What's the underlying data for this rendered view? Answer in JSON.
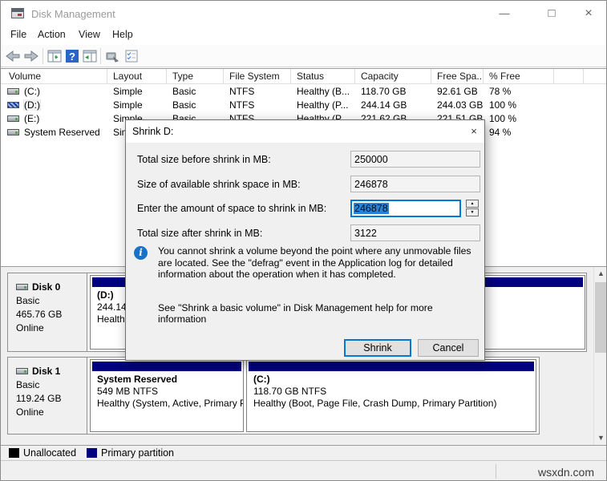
{
  "window": {
    "title": "Disk Management",
    "controls": {
      "minimize": "—",
      "maximize": "□",
      "close": "×"
    }
  },
  "menu": {
    "items": [
      "File",
      "Action",
      "View",
      "Help"
    ]
  },
  "icons": {
    "dialog_close": "×",
    "scroll_up": "▲",
    "scroll_down": "▼",
    "spin_up": "▲",
    "spin_down": "▼",
    "info": "i"
  },
  "volume_table": {
    "columns": [
      "Volume",
      "Layout",
      "Type",
      "File System",
      "Status",
      "Capacity",
      "Free Spa...",
      "% Free"
    ],
    "rows": [
      {
        "volume": "(C:)",
        "layout": "Simple",
        "type": "Basic",
        "fs": "NTFS",
        "status": "Healthy (B...",
        "capacity": "118.70 GB",
        "free": "92.61 GB",
        "pct": "78 %"
      },
      {
        "volume": "(D:)",
        "layout": "Simple",
        "type": "Basic",
        "fs": "NTFS",
        "status": "Healthy (P...",
        "capacity": "244.14 GB",
        "free": "244.03 GB",
        "pct": "100 %"
      },
      {
        "volume": "(E:)",
        "layout": "Simple",
        "type": "Basic",
        "fs": "NTFS",
        "status": "Healthy (P...",
        "capacity": "221.62 GB",
        "free": "221.51 GB",
        "pct": "100 %"
      },
      {
        "volume": "System Reserved",
        "layout": "Simple",
        "type": "",
        "fs": "",
        "status": "",
        "capacity": "",
        "free": "",
        "pct": "94 %"
      }
    ]
  },
  "dialog": {
    "title": "Shrink D:",
    "fields": [
      {
        "label": "Total size before shrink in MB:",
        "value": "250000"
      },
      {
        "label": "Size of available shrink space in MB:",
        "value": "246878"
      },
      {
        "label": "Enter the amount of space to shrink in MB:",
        "value": "246878"
      },
      {
        "label": "Total size after shrink in MB:",
        "value": "3122"
      }
    ],
    "info_text": "You cannot shrink a volume beyond the point where any unmovable files are located. See the \"defrag\" event in the Application log for detailed information about the operation when it has completed.",
    "help_text": "See \"Shrink a basic volume\" in Disk Management help for more information",
    "shrink_label": "Shrink",
    "cancel_label": "Cancel"
  },
  "disks": [
    {
      "name": "Disk 0",
      "type": "Basic",
      "size": "465.76 GB",
      "status": "Online",
      "partitions": [
        {
          "name": "(D:)",
          "size": "244.14 GB NTFS",
          "status": "Healthy (Primary Partition)"
        }
      ]
    },
    {
      "name": "Disk 1",
      "type": "Basic",
      "size": "119.24 GB",
      "status": "Online",
      "partitions": [
        {
          "name": "System Reserved",
          "size": "549 MB NTFS",
          "status": "Healthy (System, Active, Primary Partition)"
        },
        {
          "name": "(C:)",
          "size": "118.70 GB NTFS",
          "status": "Healthy (Boot, Page File, Crash Dump, Primary Partition)"
        }
      ]
    }
  ],
  "legend": {
    "items": [
      {
        "label": "Unallocated",
        "color": "#000000"
      },
      {
        "label": "Primary partition",
        "color": "#000080"
      }
    ]
  },
  "status_bar": {
    "watermark": "wsxdn.com"
  },
  "colors": {
    "partition_primary": "#000080",
    "selection": "#2a83d4",
    "accent": "#0078d7"
  }
}
